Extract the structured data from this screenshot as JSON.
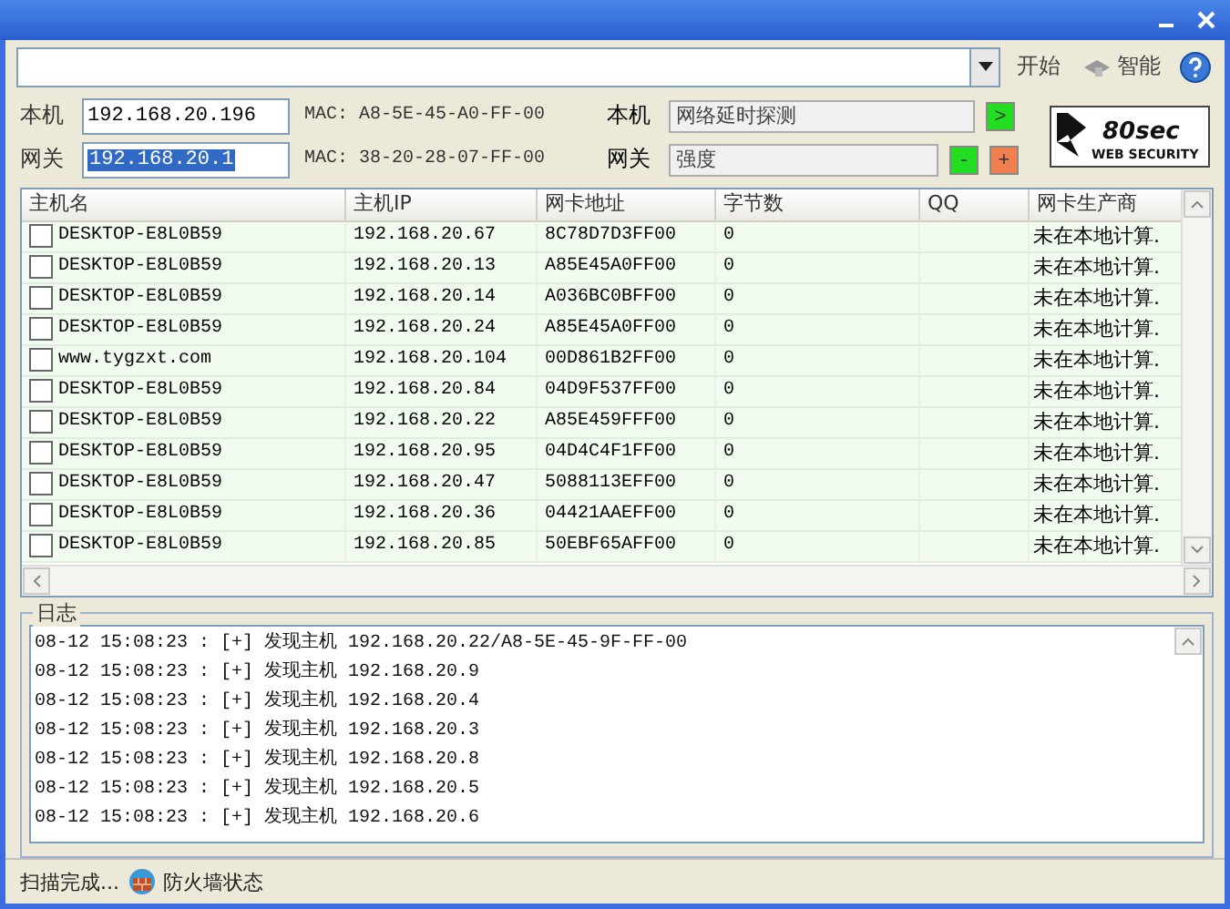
{
  "toolbar": {
    "buttons": [
      {
        "label": "开始",
        "kind": "plain"
      },
      {
        "label": "智能",
        "kind": "icon"
      }
    ]
  },
  "local": {
    "label": "本机",
    "ip": "192.168.20.196",
    "ip_highlighted": false,
    "mac": "MAC: A8-5E-45-A0-FF-00",
    "label2": "本机",
    "field2": "网络延时探测",
    "buttons": [
      {
        "label": ">",
        "color": "#22dd22"
      }
    ]
  },
  "gateway": {
    "label": "网关",
    "ip": "192.168.20.1",
    "ip_highlighted": true,
    "mac": "MAC: 38-20-28-07-FF-00",
    "label2": "网关",
    "field2": "强度",
    "buttons": [
      {
        "label": "-",
        "color": "#22dd22"
      },
      {
        "label": "+",
        "color": "#f08050"
      }
    ]
  },
  "logo": {
    "title": "80sec",
    "subtitle": "WEB SECURITY"
  },
  "table": {
    "columns": [
      "主机名",
      "主机IP",
      "网卡地址",
      "字节数",
      "QQ",
      "网卡生产商"
    ],
    "rows": [
      {
        "checked": false,
        "cells": [
          "DESKTOP-E8L0B59",
          "192.168.20.67",
          "8C78D7D3FF00",
          "0",
          "",
          "未在本地计算."
        ]
      },
      {
        "checked": false,
        "cells": [
          "DESKTOP-E8L0B59",
          "192.168.20.13",
          "A85E45A0FF00",
          "0",
          "",
          "未在本地计算."
        ]
      },
      {
        "checked": false,
        "cells": [
          "DESKTOP-E8L0B59",
          "192.168.20.14",
          "A036BC0BFF00",
          "0",
          "",
          "未在本地计算."
        ]
      },
      {
        "checked": false,
        "cells": [
          "DESKTOP-E8L0B59",
          "192.168.20.24",
          "A85E45A0FF00",
          "0",
          "",
          "未在本地计算."
        ]
      },
      {
        "checked": false,
        "cells": [
          "www.tygzxt.com",
          "192.168.20.104",
          "00D861B2FF00",
          "0",
          "",
          "未在本地计算."
        ]
      },
      {
        "checked": false,
        "cells": [
          "DESKTOP-E8L0B59",
          "192.168.20.84",
          "04D9F537FF00",
          "0",
          "",
          "未在本地计算."
        ]
      },
      {
        "checked": false,
        "cells": [
          "DESKTOP-E8L0B59",
          "192.168.20.22",
          "A85E459FFF00",
          "0",
          "",
          "未在本地计算."
        ]
      },
      {
        "checked": false,
        "cells": [
          "DESKTOP-E8L0B59",
          "192.168.20.95",
          "04D4C4F1FF00",
          "0",
          "",
          "未在本地计算."
        ]
      },
      {
        "checked": false,
        "cells": [
          "DESKTOP-E8L0B59",
          "192.168.20.47",
          "5088113EFF00",
          "0",
          "",
          "未在本地计算."
        ]
      },
      {
        "checked": false,
        "cells": [
          "DESKTOP-E8L0B59",
          "192.168.20.36",
          "04421AAEFF00",
          "0",
          "",
          "未在本地计算."
        ]
      },
      {
        "checked": false,
        "cells": [
          "DESKTOP-E8L0B59",
          "192.168.20.85",
          "50EBF65AFF00",
          "0",
          "",
          "未在本地计算."
        ]
      }
    ]
  },
  "log": {
    "title": "日志",
    "lines": [
      "08-12 15:08:23 : [+] 发现主机 192.168.20.22/A8-5E-45-9F-FF-00",
      "08-12 15:08:23 : [+] 发现主机 192.168.20.9",
      "08-12 15:08:23 : [+] 发现主机 192.168.20.4",
      "08-12 15:08:23 : [+] 发现主机 192.168.20.3",
      "08-12 15:08:23 : [+] 发现主机 192.168.20.8",
      "08-12 15:08:23 : [+] 发现主机 192.168.20.5",
      "08-12 15:08:23 : [+] 发现主机 192.168.20.6"
    ]
  },
  "status_bar": {
    "text": "扫描完成...",
    "firewall": "防火墙状态"
  }
}
